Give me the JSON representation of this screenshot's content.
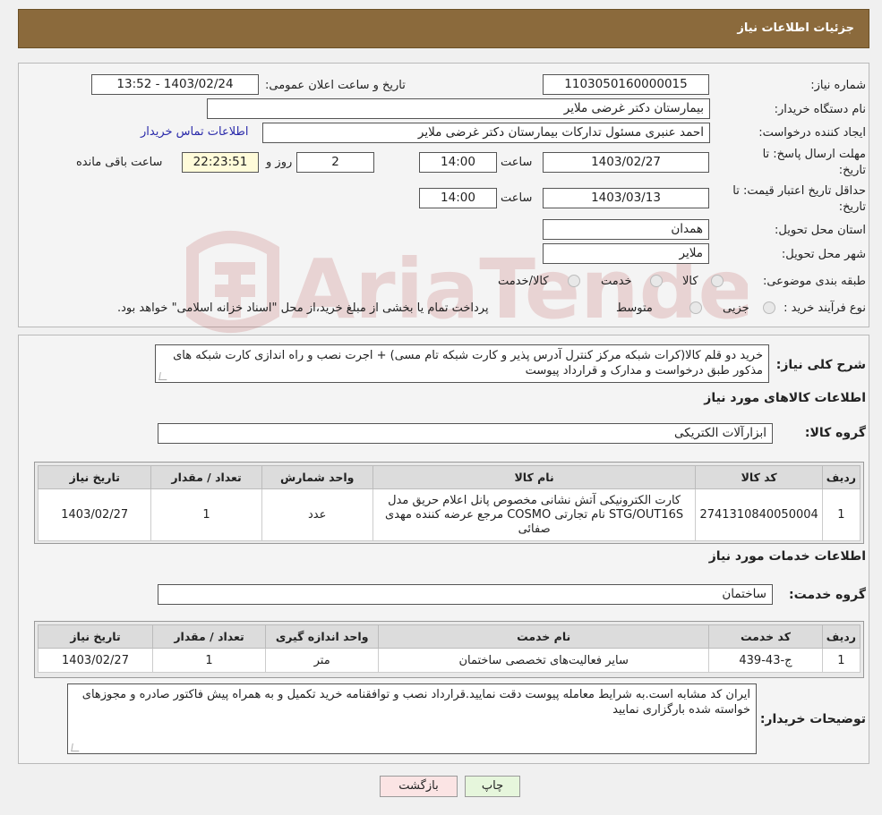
{
  "header": {
    "title": "جزئیات اطلاعات نیاز"
  },
  "form": {
    "need_number_label": "شماره نیاز:",
    "need_number": "1103050160000015",
    "announce_label": "تاریخ و ساعت اعلان عمومی:",
    "announce_value": "1403/02/24 - 13:52",
    "buyer_org_label": "نام دستگاه خریدار:",
    "buyer_org": "بیمارستان دکتر غرضی ملایر",
    "creator_label": "ایجاد کننده درخواست:",
    "creator": "احمد عنبری مسئول تدارکات بیمارستان دکتر غرضی ملایر",
    "contact_link": "اطلاعات تماس خریدار",
    "deadline_label_1": "مهلت ارسال پاسخ: تا",
    "deadline_label_2": "تاریخ:",
    "deadline_date": "1403/02/27",
    "time_label": "ساعت",
    "deadline_time": "14:00",
    "days_value": "2",
    "days_label": "روز و",
    "remaining_time": "22:23:51",
    "remaining_label": "ساعت باقی مانده",
    "validity_label_1": "حداقل تاریخ اعتبار قیمت: تا",
    "validity_label_2": "تاریخ:",
    "validity_date": "1403/03/13",
    "validity_time": "14:00",
    "province_label": "استان محل تحویل:",
    "province": "همدان",
    "city_label": "شهر محل تحویل:",
    "city": "ملایر",
    "category_label": "طبقه بندی موضوعی:",
    "category_options": [
      "کالا",
      "خدمت",
      "کالا/خدمت"
    ],
    "process_label": "نوع فرآیند خرید :",
    "process_options": [
      "جزیی",
      "متوسط"
    ],
    "process_note": "پرداخت تمام یا بخشی از مبلغ خرید،از محل \"اسناد خزانه اسلامی\" خواهد بود."
  },
  "description": {
    "label": "شرح کلی نیاز:",
    "text": "خرید دو قلم کالا(کرات شبکه مرکز کنترل آدرس پذیر و کارت شبکه تام مسی) + اجرت نصب و راه اندازی کارت شبکه های مذکور طبق درخواست و مدارک و قرارداد پیوست"
  },
  "goods": {
    "section_title": "اطلاعات کالاهای مورد نیاز",
    "group_label": "گروه کالا:",
    "group_value": "ابزارآلات الکتریکی",
    "columns": [
      "ردیف",
      "کد کالا",
      "نام کالا",
      "واحد شمارش",
      "تعداد / مقدار",
      "تاریخ نیاز"
    ],
    "rows": [
      [
        "1",
        "2741310840050004",
        "کارت الکترونیکی آتش نشانی مخصوص پانل اعلام حریق مدل STG/OUT16S نام تجارتی COSMO مرجع عرضه کننده مهدی صفائی",
        "عدد",
        "1",
        "1403/02/27"
      ]
    ]
  },
  "services": {
    "section_title": "اطلاعات خدمات مورد نیاز",
    "group_label": "گروه خدمت:",
    "group_value": "ساختمان",
    "columns": [
      "ردیف",
      "کد خدمت",
      "نام خدمت",
      "واحد اندازه گیری",
      "تعداد / مقدار",
      "تاریخ نیاز"
    ],
    "rows": [
      [
        "1",
        "ج-43-439",
        "سایر فعالیت‌های تخصصی ساختمان",
        "متر",
        "1",
        "1403/02/27"
      ]
    ]
  },
  "buyer_notes": {
    "label": "توضیحات خریدار:",
    "text": "ایران کد مشابه است.به شرایط معامله پیوست دقت نمایید.قرارداد نصب و توافقنامه خرید تکمیل و به همراه پیش فاکتور صادره و مجوزهای خواسته شده بارگزاری نمایید"
  },
  "buttons": {
    "print": "چاپ",
    "back": "بازگشت"
  },
  "watermark": {
    "text": "AriaTender.neT"
  },
  "colors": {
    "header": "#8b6a3c",
    "link": "#2a2aaa",
    "print_btn": "#e6f6dc",
    "back_btn": "#fbe4e4"
  }
}
